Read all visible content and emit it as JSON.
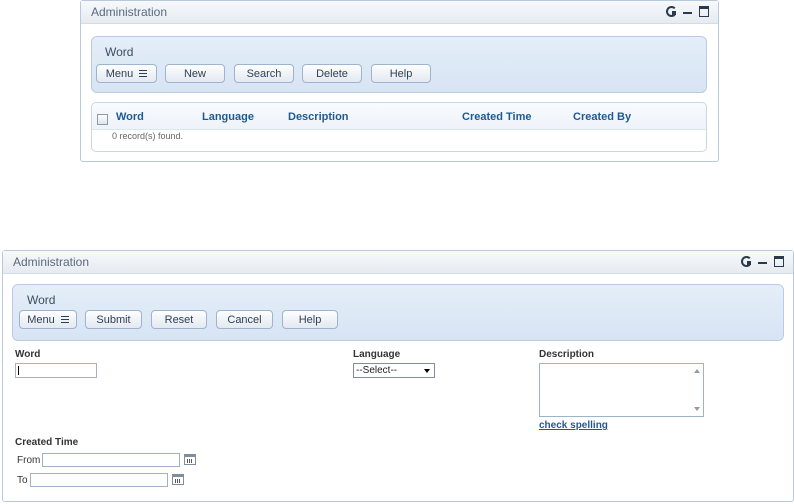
{
  "list_view": {
    "window_title": "Administration",
    "panel_title": "Word",
    "buttons": {
      "menu": "Menu",
      "new": "New",
      "search": "Search",
      "delete": "Delete",
      "help": "Help"
    },
    "columns": [
      "Word",
      "Language",
      "Description",
      "Created Time",
      "Created By"
    ],
    "records_found": "0 record(s) found."
  },
  "form_view": {
    "window_title": "Administration",
    "panel_title": "Word",
    "buttons": {
      "menu": "Menu",
      "submit": "Submit",
      "reset": "Reset",
      "cancel": "Cancel",
      "help": "Help"
    },
    "fields": {
      "word_label": "Word",
      "word_value": "",
      "language_label": "Language",
      "language_selected": "--Select--",
      "description_label": "Description",
      "description_value": "",
      "check_spelling": "check spelling",
      "created_time_label": "Created Time",
      "from_label": "From",
      "to_label": "To",
      "from_value": "",
      "to_value": ""
    }
  },
  "icons": [
    "refresh-icon",
    "minimize-icon",
    "maximize-icon",
    "menu-lines-icon",
    "calendar-icon"
  ]
}
